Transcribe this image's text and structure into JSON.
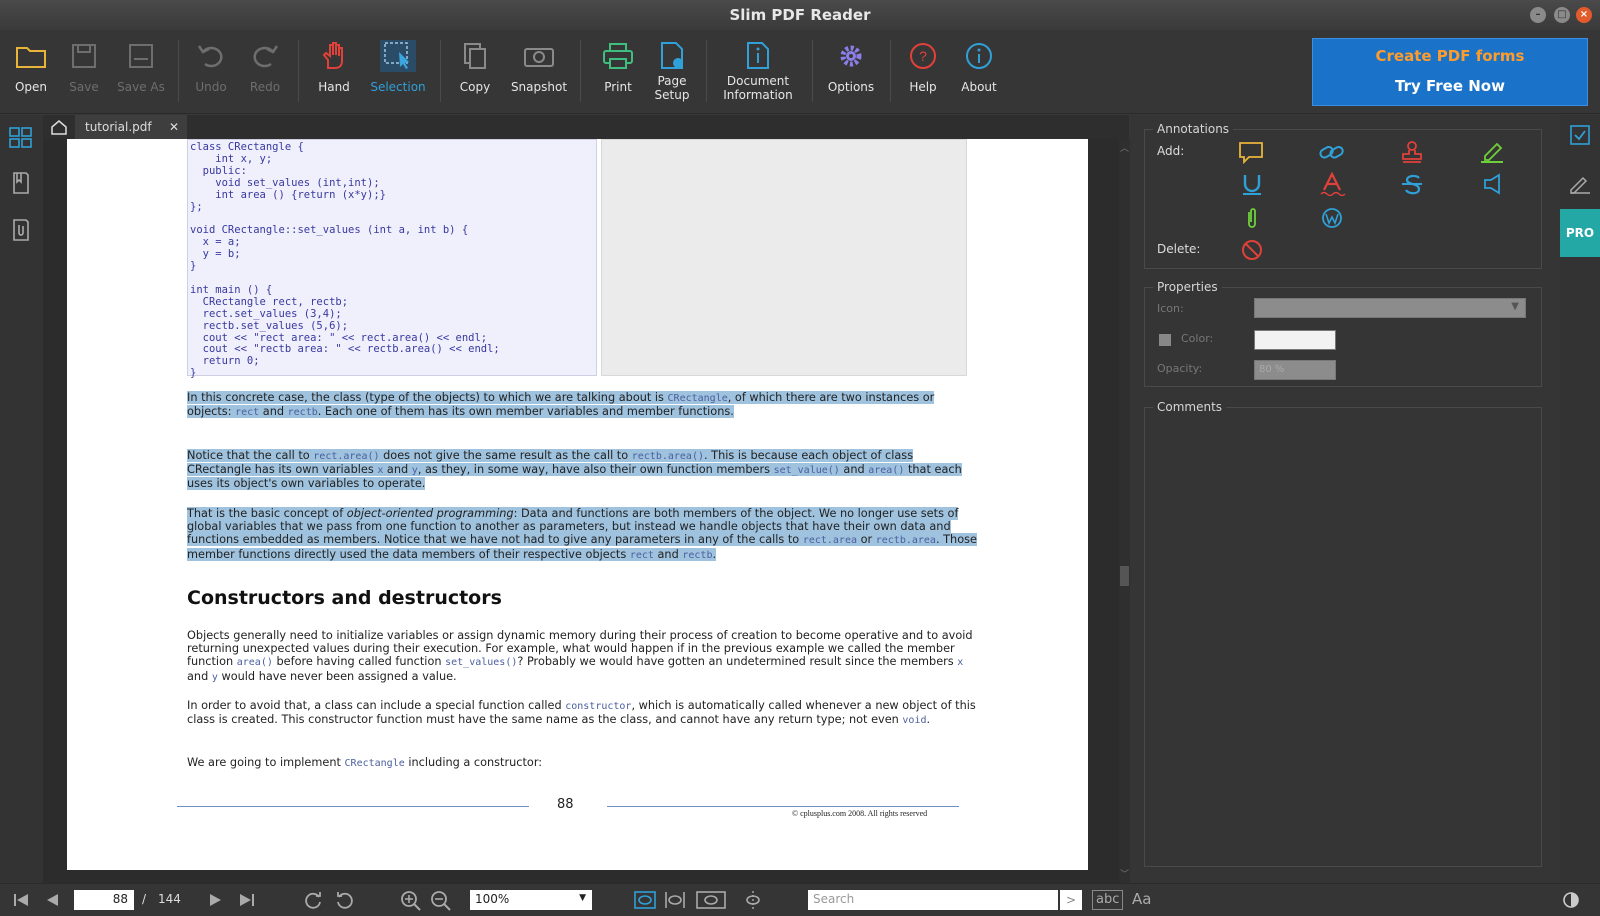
{
  "app": {
    "title": "Slim PDF Reader"
  },
  "toolbar": {
    "open": "Open",
    "save": "Save",
    "save_as": "Save As",
    "undo": "Undo",
    "redo": "Redo",
    "hand": "Hand",
    "selection": "Selection",
    "copy": "Copy",
    "snapshot": "Snapshot",
    "print": "Print",
    "page_setup_1": "Page",
    "page_setup_2": "Setup",
    "doc_info_1": "Document",
    "doc_info_2": "Information",
    "options": "Options",
    "help": "Help",
    "about": "About"
  },
  "promo": {
    "line1": "Create PDF forms",
    "line2": "Try Free Now"
  },
  "tab": {
    "name": "tutorial.pdf",
    "close": "✕"
  },
  "document": {
    "code1": "class CRectangle {\n    int x, y;\n  public:\n    void set_values (int,int);\n    int area () {return (x*y);}\n};\n\nvoid CRectangle::set_values (int a, int b) {\n  x = a;\n  y = b;\n}\n\nint main () {\n  CRectangle rect, rectb;\n  rect.set_values (3,4);\n  rectb.set_values (5,6);\n  cout << \"rect area: \" << rect.area() << endl;\n  cout << \"rectb area: \" << rectb.area() << endl;\n  return 0;\n}",
    "p1": [
      {
        "t": "In this concrete case, the class (type of the objects) to which we are talking about is "
      },
      {
        "t": "CRectangle",
        "m": true
      },
      {
        "t": ", of which there are two instances or objects: "
      },
      {
        "t": "rect",
        "m": true
      },
      {
        "t": " and "
      },
      {
        "t": "rectb",
        "m": true
      },
      {
        "t": ". Each one of them has its own member variables and member functions."
      }
    ],
    "p2": [
      {
        "t": "Notice that the call to "
      },
      {
        "t": "rect.area()",
        "m": true
      },
      {
        "t": " does not give the same result as the call to "
      },
      {
        "t": "rectb.area()",
        "m": true
      },
      {
        "t": ". This is because each object of class CRectangle has its own variables "
      },
      {
        "t": "x",
        "m": true
      },
      {
        "t": " and "
      },
      {
        "t": "y",
        "m": true
      },
      {
        "t": ", as they, in some way, have also their own function members "
      },
      {
        "t": "set_value()",
        "m": true
      },
      {
        "t": " and "
      },
      {
        "t": "area()",
        "m": true
      },
      {
        "t": " that each uses its object's own variables to operate."
      }
    ],
    "p3": [
      {
        "t": "That is the basic concept of "
      },
      {
        "t": "object-oriented programming",
        "i": true
      },
      {
        "t": ": Data and functions are both members of the object. We no longer use sets of global variables that we pass from one function to another as parameters, but instead we handle objects that have their own data and functions embedded as members. Notice that we have not had to give any parameters in any of the calls to "
      },
      {
        "t": "rect.area",
        "m": true
      },
      {
        "t": " or "
      },
      {
        "t": "rectb.area",
        "m": true
      },
      {
        "t": ". Those member functions directly used the data members of their respective objects "
      },
      {
        "t": "rect",
        "m": true
      },
      {
        "t": " and "
      },
      {
        "t": "rectb",
        "m": true
      },
      {
        "t": "."
      }
    ],
    "heading": "Constructors and destructors",
    "p4": [
      {
        "t": "Objects generally need to initialize variables or assign dynamic memory during their process of creation to become operative and to avoid returning unexpected values during their execution. For example, what would happen if in the previous example we called the member function "
      },
      {
        "t": "area()",
        "m": true
      },
      {
        "t": " before having called function "
      },
      {
        "t": "set_values()",
        "m": true
      },
      {
        "t": "? Probably we would have gotten an undetermined result since the members "
      },
      {
        "t": "x",
        "m": true
      },
      {
        "t": " and "
      },
      {
        "t": "y",
        "m": true
      },
      {
        "t": " would have never been assigned a value."
      }
    ],
    "p5": [
      {
        "t": "In order to avoid that, a class can include a special function called "
      },
      {
        "t": "constructor",
        "m": true
      },
      {
        "t": ", which is automatically called whenever a new object of this class is created. This constructor function must have the same name as the class, and cannot have any return type; not even "
      },
      {
        "t": "void",
        "m": true
      },
      {
        "t": "."
      }
    ],
    "p6": [
      {
        "t": "We are going to implement "
      },
      {
        "t": "CRectangle",
        "m": true
      },
      {
        "t": " including a constructor:"
      }
    ],
    "page_number": "88",
    "copyright": "© cplusplus.com 2008. All rights reserved"
  },
  "annotations": {
    "title": "Annotations",
    "add_label": "Add:",
    "delete_label": "Delete:"
  },
  "properties": {
    "title": "Properties",
    "icon_label": "Icon:",
    "color_label": "Color:",
    "opacity_label": "Opacity:",
    "opacity_value": "80 %"
  },
  "comments": {
    "title": "Comments"
  },
  "side": {
    "pro": "PRO"
  },
  "status": {
    "page_current": "88",
    "page_sep": "/",
    "page_total": "144",
    "zoom": "100%",
    "search_placeholder": "Search",
    "abc": "abc",
    "aa": "Aa"
  },
  "colors": {
    "accent": "#2fa0d8",
    "promo_bg": "#1b73c9",
    "promo_text": "#ff9c2a",
    "highlight": "#9fc2de"
  }
}
